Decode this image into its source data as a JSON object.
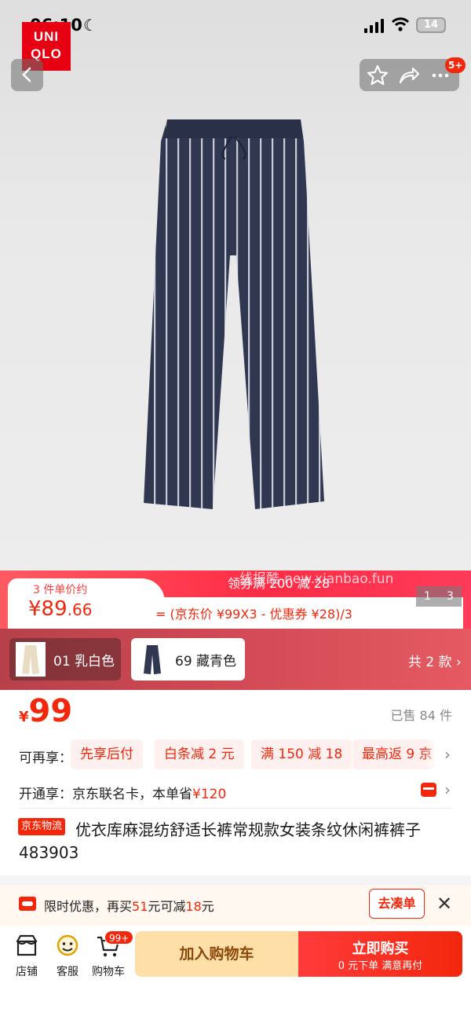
{
  "status_bar": {
    "time": "06:10",
    "battery": "14"
  },
  "brand": {
    "logo_line1": "UNI",
    "logo_line2": "QLO"
  },
  "header": {
    "cart_badge": "5+"
  },
  "price_banner": {
    "coupon_text": "领券满 200 减 28",
    "per_unit_label": "3 件单价约",
    "per_unit_price_int": "¥89",
    "per_unit_price_dec": ".66",
    "formula": "= (京东价 ¥99X3 - 优惠券 ¥28)/3",
    "pager_current": "1",
    "pager_total": "3",
    "watermark": "线报酷-new.xianbao.fun"
  },
  "variants": {
    "items": [
      {
        "label": "01 乳白色",
        "selected": false
      },
      {
        "label": "69 藏青色",
        "selected": true
      }
    ],
    "total_label": "共 2 款 ›"
  },
  "product": {
    "currency": "¥",
    "price": "99",
    "sold": "已售 84 件",
    "benefits_label": "可再享：",
    "benefit_tags": [
      "先享后付",
      "白条减 2 元",
      "满 150 减 18",
      "最高返 9 京"
    ],
    "member_prefix": "开通享：京东联名卡，本单省",
    "member_saving": "¥120",
    "logistics_badge": "京东物流",
    "title_line1": "优衣库麻混纺舒适长裤常规款女装条纹休闲裤裤子",
    "title_line2": "483903"
  },
  "promo": {
    "text_a": "限时优惠，再买",
    "amount1": "51",
    "text_b": "元可减",
    "amount2": "18",
    "text_c": "元",
    "button": "去凑单"
  },
  "bottom_bar": {
    "store": "店铺",
    "service": "客服",
    "cart": "购物车",
    "cart_badge": "99+",
    "add_to_cart": "加入购物车",
    "buy_now": "立即购买",
    "buy_now_sub": "0 元下单 满意再付"
  },
  "colors": {
    "brand_red": "#e60012",
    "jd_red": "#f2270c",
    "cart_button": "#ffdfa8"
  }
}
